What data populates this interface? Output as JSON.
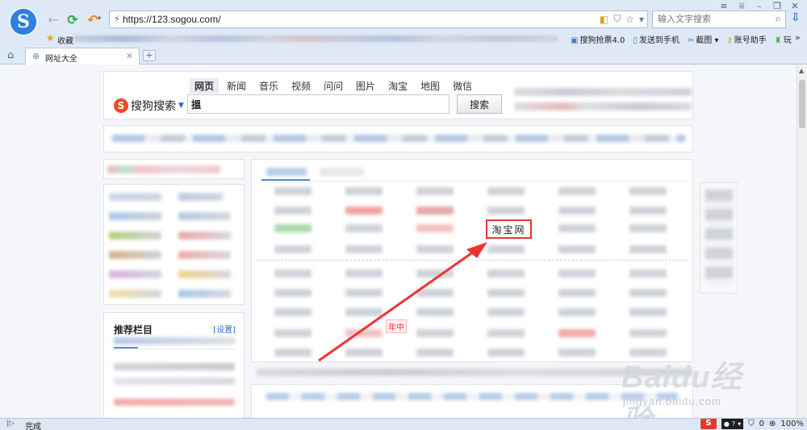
{
  "browser": {
    "url": "https://123.sogou.com/",
    "search_placeholder": "输入文字搜索",
    "logo_glyph": "S",
    "window_controls": [
      "≡",
      "♕",
      "–",
      "❐",
      "✕"
    ]
  },
  "favorites": {
    "label": "收藏",
    "tools": [
      "搜狗抢票4.0",
      "发送到手机",
      "截图",
      "账号助手",
      "玩"
    ],
    "more": "»"
  },
  "tabs": [
    {
      "label": "网址大全"
    }
  ],
  "search": {
    "tabs": [
      "网页",
      "新闻",
      "音乐",
      "视频",
      "问问",
      "图片",
      "淘宝",
      "地图",
      "微信"
    ],
    "active_tab": "网页",
    "logo_text": "搜狗搜索",
    "logo_letter": "S",
    "query": "搵",
    "button": "搜索"
  },
  "recommend": {
    "title": "推荐栏目",
    "settings_link": "[设置]"
  },
  "content": {
    "taobao_link": "淘宝网",
    "red_tag": "年中"
  },
  "watermark": {
    "main": "Baidu经验",
    "sub": "jingyan.baidu.com"
  },
  "statusbar": {
    "text": "完成",
    "ime_logo": "S",
    "count": "0",
    "zoom": "100%"
  },
  "colors": {
    "chrome_bg": "#dfe9f5",
    "accent_blue": "#2a6ed1",
    "sogou_red": "#f04b23",
    "highlight_red": "#e33333"
  }
}
